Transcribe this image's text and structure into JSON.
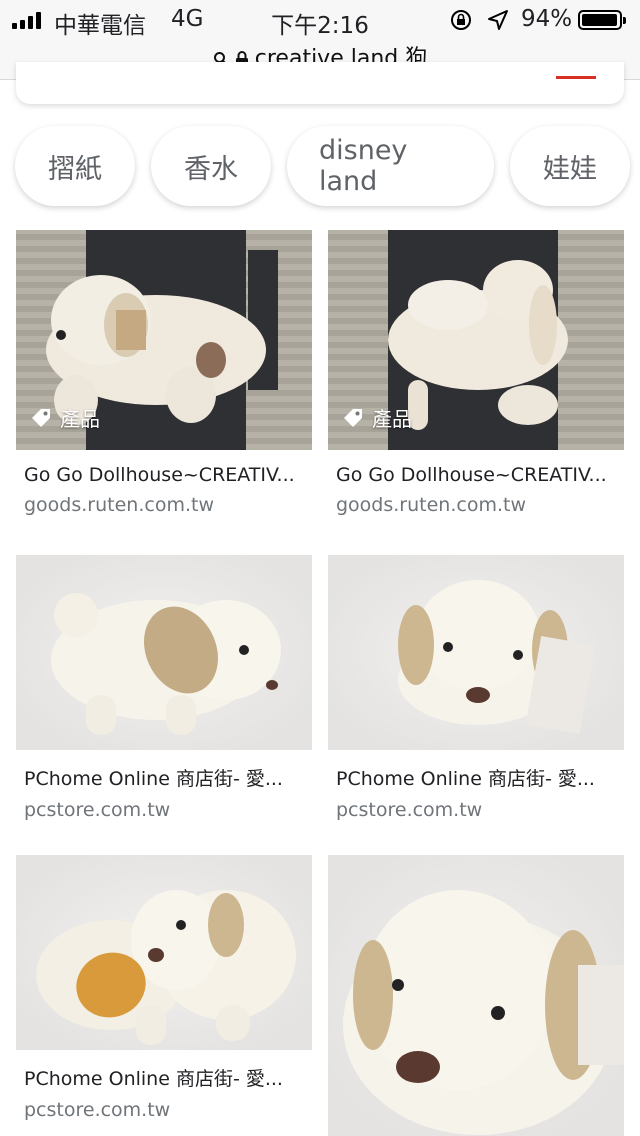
{
  "status_bar": {
    "carrier": "中華電信",
    "network": "4G",
    "time": "下午2:16",
    "battery_percent": "94%",
    "battery_level": 0.94
  },
  "browser": {
    "url": "creative land 狗"
  },
  "chips": [
    "摺紙",
    "香水",
    "disney land",
    "娃娃"
  ],
  "results": [
    {
      "title": "Go Go Dollhouse~CREATIV...",
      "domain": "goods.ruten.com.tw",
      "badge": "產品"
    },
    {
      "title": "Go Go Dollhouse~CREATIV...",
      "domain": "goods.ruten.com.tw",
      "badge": "產品"
    },
    {
      "title": "PChome Online 商店街- 愛...",
      "domain": "pcstore.com.tw"
    },
    {
      "title": "PChome Online 商店街- 愛...",
      "domain": "pcstore.com.tw"
    },
    {
      "title": "PChome Online 商店街- 愛...",
      "domain": "pcstore.com.tw"
    }
  ],
  "colors": {
    "accent": "#d93025",
    "link_text": "#202124",
    "domain_text": "#70757a"
  }
}
